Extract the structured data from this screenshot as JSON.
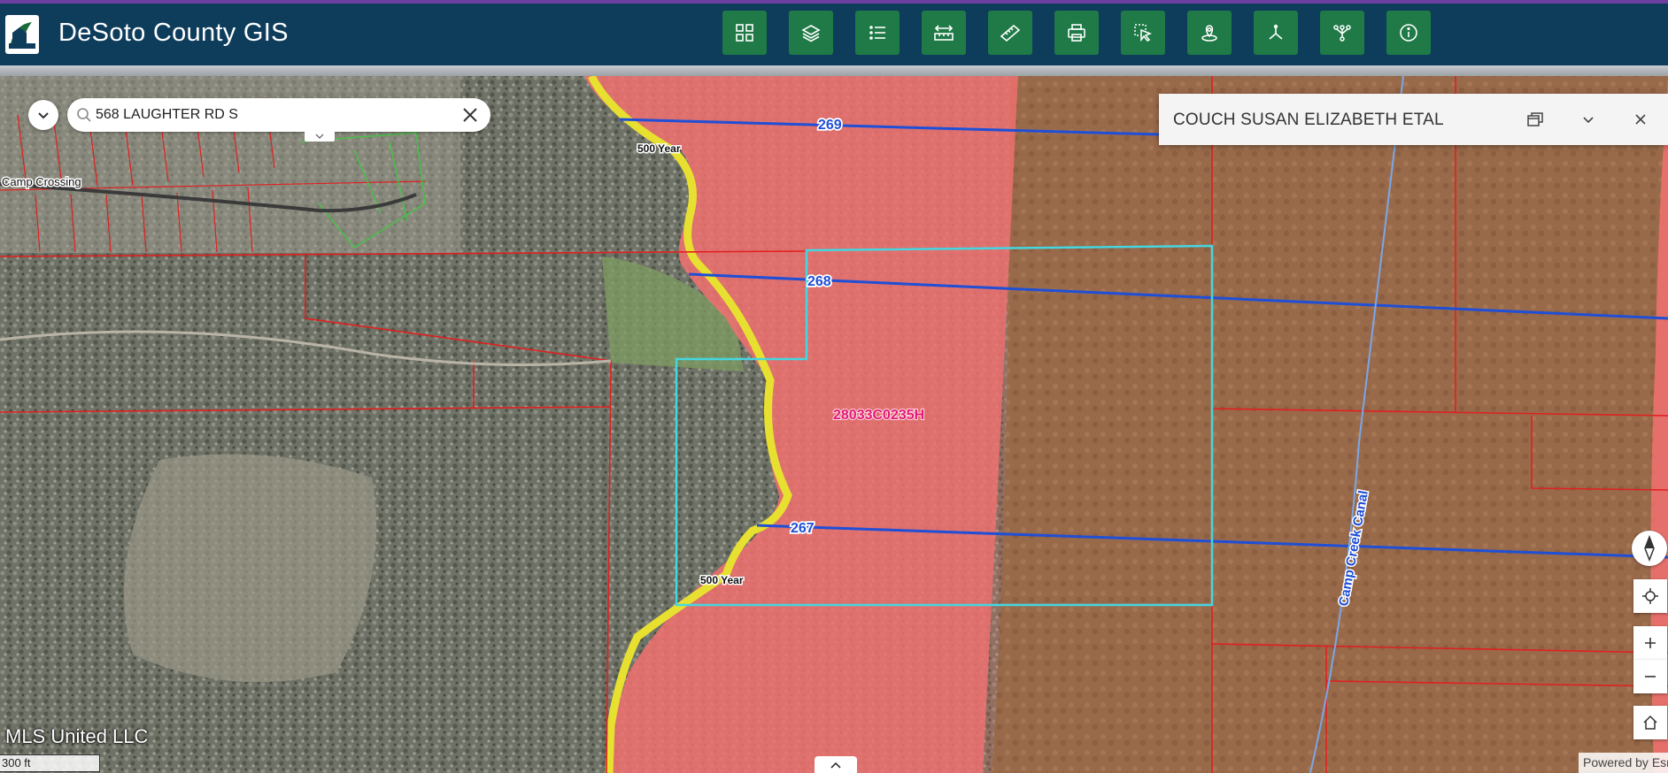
{
  "header": {
    "title": "DeSoto County GIS",
    "tools": [
      {
        "icon": "widgets-grid-icon"
      },
      {
        "icon": "layers-icon"
      },
      {
        "icon": "legend-list-icon"
      },
      {
        "icon": "measure-area-icon"
      },
      {
        "icon": "ruler-icon"
      },
      {
        "icon": "print-icon"
      },
      {
        "icon": "select-tool-icon"
      },
      {
        "icon": "location-pin-icon"
      },
      {
        "icon": "coordinate-icon"
      },
      {
        "icon": "network-trace-icon"
      },
      {
        "icon": "info-icon"
      }
    ]
  },
  "search": {
    "value": "568 LAUGHTER RD S"
  },
  "popup": {
    "title": "COUCH SUSAN ELIZABETH ETAL"
  },
  "map": {
    "labels": {
      "camp_crossing": "Camp Crossing",
      "flood_500_top": "500 Year",
      "flood_500_bottom": "500 Year",
      "contour_269": "269",
      "contour_268": "268",
      "contour_267": "267",
      "panel_id": "28033C0235H",
      "canal": "Camp Creek Canal"
    }
  },
  "attribution": "MLS United LLC",
  "scalebar": "300 ft",
  "powered_by": "Powered by Esri",
  "colors": {
    "header": "#0e3d5c",
    "tool_button": "#1f7a47",
    "flood_zone": "#f27070",
    "parcel_line": "#e02020",
    "contour_line": "#1f4fd6",
    "selection": "#45d6e0",
    "flood_500": "#e8e030"
  }
}
